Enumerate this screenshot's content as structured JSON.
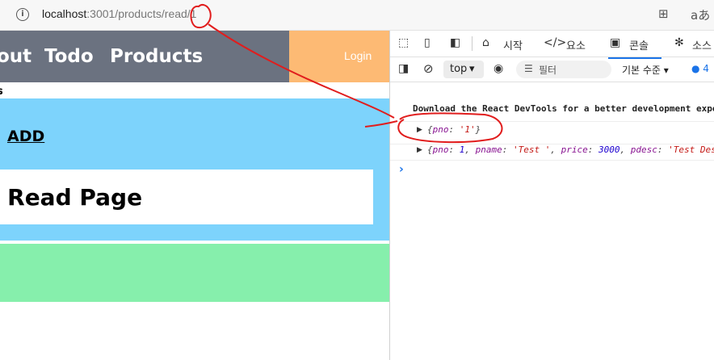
{
  "browser": {
    "url_host": "localhost",
    "url_rest": ":3001/products/read/1",
    "icons": [
      "info-icon",
      "extensions-icon",
      "translate-icon"
    ]
  },
  "page": {
    "nav": [
      "out",
      "Todo",
      "Products"
    ],
    "login": "Login",
    "breadcrumb": "s",
    "add_link": "ADD",
    "title": "t Read Page",
    "colors": {
      "navbar": "#6b7280",
      "login_bg": "#fdba74",
      "blue": "#7dd3fc",
      "green": "#86efac"
    }
  },
  "devtools": {
    "tabs": {
      "welcome": "시작",
      "elements": "요소",
      "console": "콘솔",
      "sources": "소스"
    },
    "context": "top",
    "filter_placeholder": "필터",
    "level": "기본 수준",
    "issues_count": "4",
    "messages": {
      "devtools_hint": "Download the React DevTools for a better development expe",
      "params_obj": {
        "key": "pno",
        "value": "'1'"
      },
      "product_obj": {
        "pno_key": "pno",
        "pno_val": "1",
        "pname_key": "pname",
        "pname_val": "'Test '",
        "price_key": "price",
        "price_val": "3000",
        "pdesc_key": "pdesc",
        "pdesc_val": "'Test Des"
      }
    }
  }
}
